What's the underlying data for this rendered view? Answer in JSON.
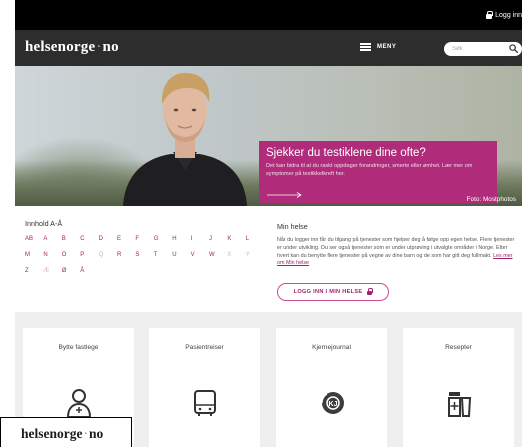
{
  "top": {
    "login_label": "Logg inn"
  },
  "nav": {
    "logo_main": "helsenorge",
    "logo_dot": "·",
    "logo_tld": "no",
    "menu_label": "MENY",
    "search_placeholder": "Søk"
  },
  "hero": {
    "title": "Sjekker du testiklene dine ofte?",
    "text": "Det kan bidra til at du raskt oppdager forandringer, smerte eller ømhet. Lær mer om symptomer på testikkelkreft her.",
    "credit": "Foto: Mostphotos"
  },
  "az": {
    "title": "Innhold A-Å",
    "rows": [
      [
        "AB",
        "A",
        "B",
        "C",
        "D",
        "E",
        "F",
        "G",
        "H",
        "I",
        "J",
        "K",
        "L"
      ],
      [
        "M",
        "N",
        "O",
        "P",
        "Q",
        "R",
        "S",
        "T",
        "U",
        "V",
        "W",
        "X",
        "Y"
      ],
      [
        "Z",
        "Æ",
        "Ø",
        "Å"
      ]
    ],
    "dim_letters": [
      "Q",
      "X",
      "Y",
      "Æ"
    ]
  },
  "min_helse": {
    "title": "Min helse",
    "text": "Når du logger inn får du tilgang på tjenester som hjelper deg å følge opp egen helse. Flere tjenester er under utvikling. Du ser også tjenester som er under utprøving i utvalgte områder i Norge. Etter hvert kan du benytte flere tjenester på vegne av dine barn og de som har gitt deg fullmakt.",
    "link": "Les mer om Min helse",
    "login_button": "LOGG INN I MIN HELSE"
  },
  "cards": [
    {
      "label": "Bytte fastlege",
      "icon": "doctor-icon"
    },
    {
      "label": "Pasientreiser",
      "icon": "bus-icon"
    },
    {
      "label": "Kjernejournal",
      "icon": "journal-icon"
    },
    {
      "label": "Resepter",
      "icon": "medicine-icon"
    }
  ],
  "popup": {
    "logo_main": "helsenorge",
    "logo_dot": "·",
    "logo_tld": "no"
  },
  "colors": {
    "brand": "#a0236d",
    "hero_box": "#b02c7a",
    "navbar": "#2d2d2d"
  }
}
